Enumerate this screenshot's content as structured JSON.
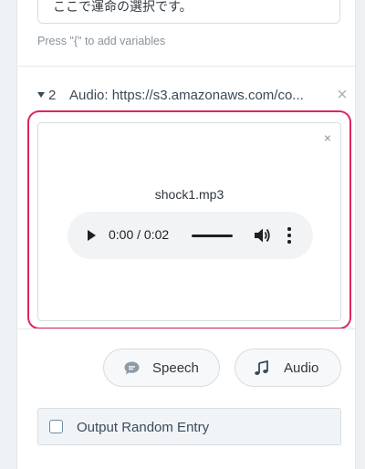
{
  "prompt_field": {
    "value": "ここで運命の選択です。",
    "hint": "Press \"{\" to add variables"
  },
  "step": {
    "number": "2",
    "title": "Audio: https://s3.amazonaws.com/co...",
    "remove_icon": "×"
  },
  "audio_card": {
    "close_icon": "×",
    "file_name": "shock1.mp3",
    "player": {
      "time": "0:00 / 0:02",
      "progress": 0
    }
  },
  "add_buttons": {
    "speech_label": "Speech",
    "audio_label": "Audio"
  },
  "random_entry": {
    "label": "Output Random Entry",
    "checked": false
  },
  "colors": {
    "highlight": "#e0245e",
    "panel_bg": "#ffffff",
    "page_bg": "#eef1f4"
  },
  "icons": [
    "caret-down-icon",
    "close-icon",
    "play-icon",
    "volume-icon",
    "more-vertical-icon",
    "speech-bubble-icon",
    "music-note-icon",
    "checkbox-icon"
  ]
}
